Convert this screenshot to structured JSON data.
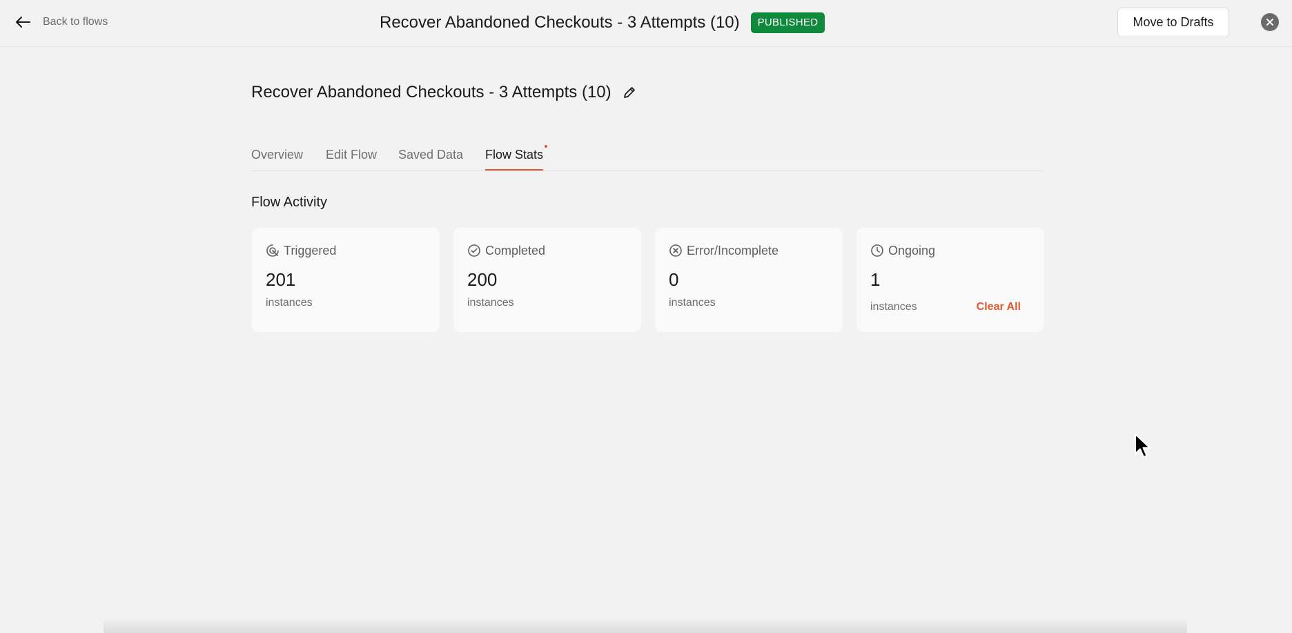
{
  "topbar": {
    "back_label": "Back to flows",
    "title": "Recover Abandoned Checkouts - 3 Attempts (10)",
    "status": "PUBLISHED",
    "status_color": "#0f8a3c",
    "move_to_drafts_label": "Move to Drafts"
  },
  "page": {
    "title": "Recover Abandoned Checkouts - 3 Attempts (10)"
  },
  "tabs": [
    {
      "label": "Overview",
      "active": false
    },
    {
      "label": "Edit Flow",
      "active": false
    },
    {
      "label": "Saved Data",
      "active": false
    },
    {
      "label": "Flow Stats",
      "active": true,
      "has_dot": true
    }
  ],
  "accent_color": "#e4572e",
  "activity": {
    "title": "Flow Activity",
    "cards": [
      {
        "icon": "triggered-icon",
        "label": "Triggered",
        "value": "201",
        "unit": "instances"
      },
      {
        "icon": "check-circle-icon",
        "label": "Completed",
        "value": "200",
        "unit": "instances"
      },
      {
        "icon": "x-circle-icon",
        "label": "Error/Incomplete",
        "value": "0",
        "unit": "instances"
      },
      {
        "icon": "clock-icon",
        "label": "Ongoing",
        "value": "1",
        "unit": "instances",
        "action": "Clear All"
      }
    ]
  }
}
